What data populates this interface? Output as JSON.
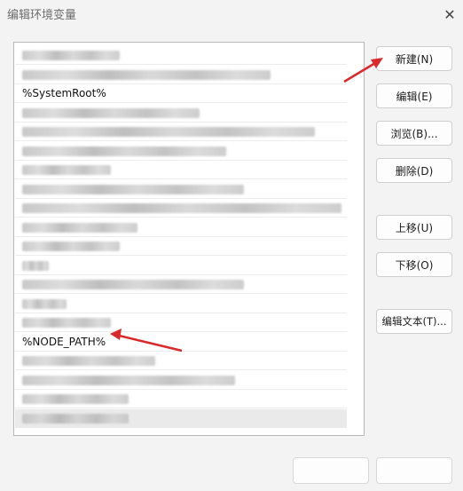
{
  "window": {
    "title": "编辑环境变量"
  },
  "list": {
    "rows": [
      {
        "text": "",
        "blurred": true,
        "blur_w": 110
      },
      {
        "text": "",
        "blurred": true,
        "blur_w": 280
      },
      {
        "text": "%SystemRoot%",
        "blurred": false
      },
      {
        "text": "",
        "blurred": true,
        "blur_w": 200
      },
      {
        "text": "",
        "blurred": true,
        "blur_w": 330
      },
      {
        "text": "",
        "blurred": true,
        "blur_w": 230
      },
      {
        "text": "",
        "blurred": true,
        "blur_w": 100
      },
      {
        "text": "",
        "blurred": true,
        "blur_w": 250
      },
      {
        "text": "",
        "blurred": true,
        "blur_w": 360
      },
      {
        "text": "",
        "blurred": true,
        "blur_w": 130
      },
      {
        "text": "",
        "blurred": true,
        "blur_w": 110
      },
      {
        "text": "",
        "blurred": true,
        "blur_w": 30
      },
      {
        "text": "",
        "blurred": true,
        "blur_w": 250
      },
      {
        "text": "",
        "blurred": true,
        "blur_w": 50
      },
      {
        "text": "",
        "blurred": true,
        "blur_w": 100
      },
      {
        "text": "%NODE_PATH%",
        "blurred": false
      },
      {
        "text": "",
        "blurred": true,
        "blur_w": 150
      },
      {
        "text": "",
        "blurred": true,
        "blur_w": 240
      },
      {
        "text": "",
        "blurred": true,
        "blur_w": 120
      },
      {
        "text": "",
        "blurred": true,
        "blur_w": 120,
        "selected": true
      }
    ]
  },
  "buttons": {
    "new": "新建(N)",
    "edit": "编辑(E)",
    "browse": "浏览(B)...",
    "delete": "删除(D)",
    "move_up": "上移(U)",
    "move_down": "下移(O)",
    "edit_text": "编辑文本(T)..."
  },
  "colors": {
    "annotation_arrow": "#d9292b",
    "background": "#f3f3f3"
  }
}
